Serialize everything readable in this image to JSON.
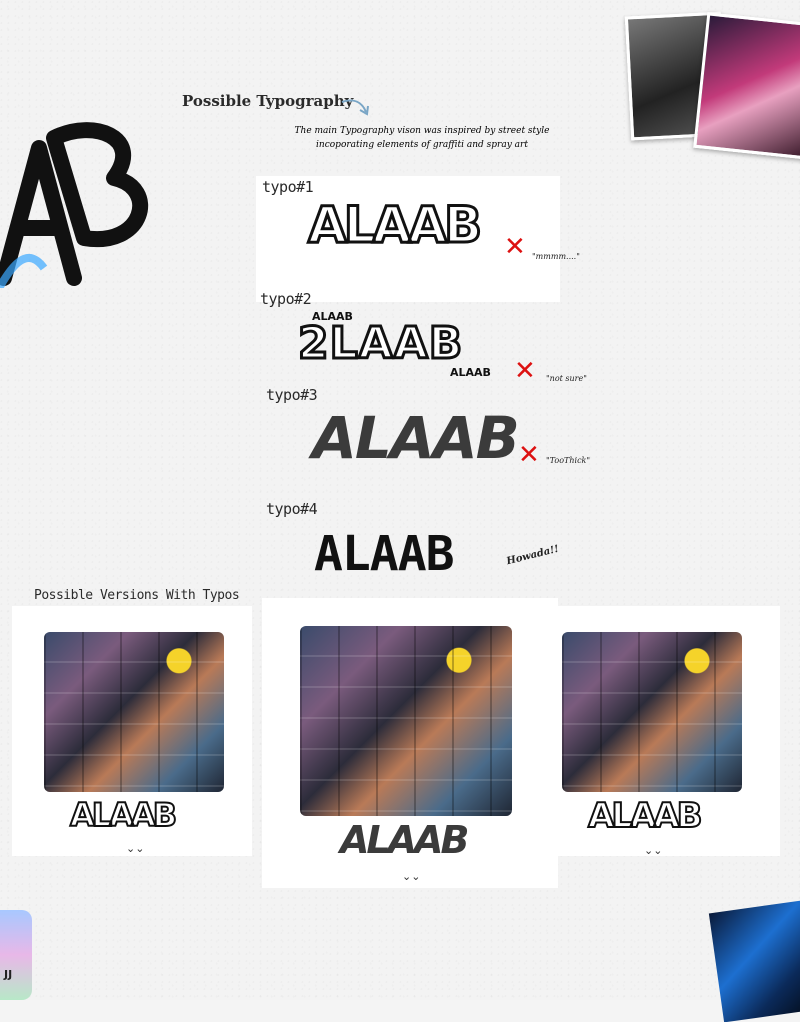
{
  "heading": "Possible Typography",
  "intro_line1": "The main Typography vison was inspired by street style",
  "intro_line2": "incoporating elements of graffiti and spray art",
  "typos": [
    {
      "label": "typo#1",
      "word": "ALAAB",
      "note": "\"mmmm....\""
    },
    {
      "label": "typo#2",
      "word": "2LAAB",
      "small_top": "ALAAB",
      "small_bottom": "ALAAB",
      "note": "\"not sure\""
    },
    {
      "label": "typo#3",
      "word": "ALAAB",
      "note": "\"TooThick\""
    },
    {
      "label": "typo#4",
      "word": "ALAAB",
      "note": "Howada!!"
    }
  ],
  "versions_heading": "Possible Versions With Typos",
  "versions": [
    {
      "word": "ALAAB",
      "mark": "⌄⌄"
    },
    {
      "word": "ALAAB",
      "mark": "⌄⌄"
    },
    {
      "word": "ALAAB",
      "mark": "⌄⌄"
    }
  ],
  "corner_logo": "AB",
  "corner_badge": "JJ",
  "x_glyph": "✕"
}
